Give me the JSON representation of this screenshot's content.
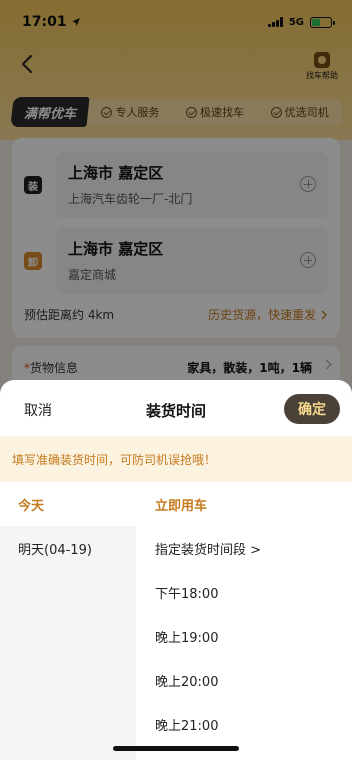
{
  "status_bar": {
    "time": "17:01",
    "network": "5G"
  },
  "header": {
    "help_label": "找车帮助"
  },
  "brand": {
    "logo_text": "满帮优车",
    "features": [
      "专人服务",
      "极速找车",
      "优选司机"
    ]
  },
  "route": {
    "load": {
      "tag": "装",
      "city": "上海市 嘉定区",
      "address": "上海汽车齿轮一厂-北门"
    },
    "unload": {
      "tag": "卸",
      "city": "上海市 嘉定区",
      "address": "嘉定商城"
    },
    "distance": "预估距离约 4km",
    "history_link": "历史货源，快速重发"
  },
  "cargo": {
    "required_mark": "*",
    "label": "货物信息",
    "value": "家具，散装，1吨，1辆"
  },
  "sheet": {
    "cancel_label": "取消",
    "title": "装货时间",
    "confirm_label": "确定",
    "tip": "填写准确装货时间，可防司机误抢哦！",
    "days": [
      {
        "label": "今天",
        "selected": true
      },
      {
        "label": "明天(04-19)",
        "selected": false
      }
    ],
    "times": [
      {
        "label": "立即用车",
        "selected": true
      },
      {
        "label": "指定装货时间段 >",
        "selected": false
      },
      {
        "label": "下午18:00",
        "selected": false
      },
      {
        "label": "晚上19:00",
        "selected": false
      },
      {
        "label": "晚上20:00",
        "selected": false
      },
      {
        "label": "晚上21:00",
        "selected": false
      }
    ]
  },
  "colors": {
    "accent": "#c67a1e",
    "header_yellow": "#f4c65a",
    "confirm_bg": "#4a4137",
    "confirm_text": "#f6d88f",
    "tip_bg": "#fbf2df"
  }
}
